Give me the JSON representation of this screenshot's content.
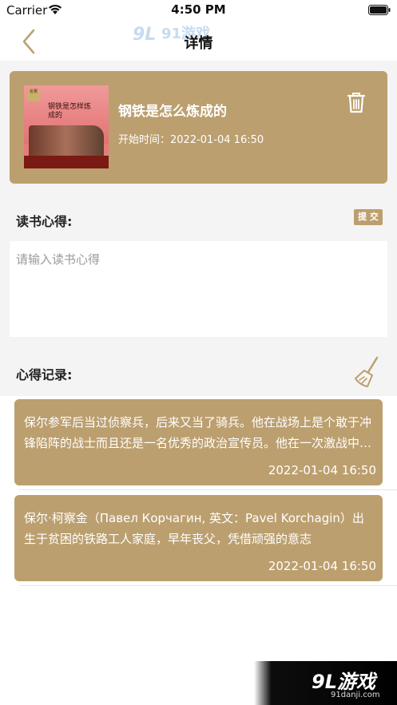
{
  "status_bar": {
    "carrier": "Carrier",
    "time": "4:50 PM"
  },
  "nav": {
    "title": "详情",
    "logo_text": "91游戏",
    "back_icon": "chevron-left-icon"
  },
  "book": {
    "title": "钢铁是怎么炼成的",
    "start_time": "开始时间：2022-01-04 16:50",
    "cover_title": "钢铁是怎样炼成的",
    "cover_badge": "名著"
  },
  "notes": {
    "label": "读书心得:",
    "submit_label": "提 交",
    "placeholder": "请输入读书心得",
    "value": ""
  },
  "records": {
    "label": "心得记录:",
    "clear_icon": "broom-icon",
    "items": [
      {
        "text": "保尔参军后当过侦察兵，后来又当了骑兵。他在战场上是个敢于冲锋陷阵的战士而且还是一名优秀的政治宣传员。他在一次激战中头部受了重伤",
        "date": "2022-01-04 16:50"
      },
      {
        "text": "保尔·柯察金（Павел Корчагин, 英文：Pavel Korchagin）出生于贫困的铁路工人家庭，早年丧父，凭借顽强的意志",
        "date": "2022-01-04 16:50"
      }
    ]
  },
  "watermark": {
    "logo": "9L游戏",
    "url": "91danji.com"
  },
  "colors": {
    "accent": "#bc9f6f",
    "background": "#f4f4f4"
  }
}
